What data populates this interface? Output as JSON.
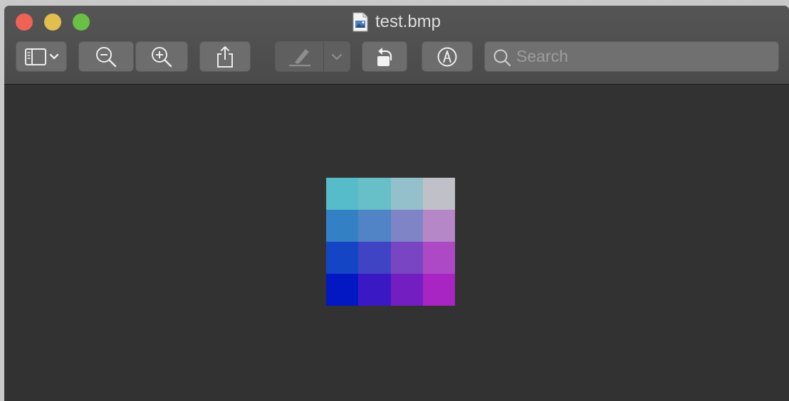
{
  "window": {
    "title": "test.bmp"
  },
  "toolbar": {
    "buttons": [
      {
        "name": "sidebar-toggle",
        "icon": "sidebar-icon"
      },
      {
        "name": "zoom-out",
        "icon": "zoom-out-icon"
      },
      {
        "name": "zoom-in",
        "icon": "zoom-in-icon"
      },
      {
        "name": "share",
        "icon": "share-icon"
      },
      {
        "name": "highlight",
        "icon": "highlighter-icon"
      },
      {
        "name": "rotate",
        "icon": "rotate-left-icon"
      },
      {
        "name": "markup",
        "icon": "markup-icon"
      }
    ]
  },
  "search": {
    "placeholder": "Search",
    "value": ""
  },
  "image": {
    "pixels": [
      [
        "#57bcc9",
        "#67bfc7",
        "#93c0cb",
        "#c0c0c8"
      ],
      [
        "#3380c4",
        "#5184c6",
        "#7f84c7",
        "#b587c7"
      ],
      [
        "#1445c4",
        "#3f44c4",
        "#7945c2",
        "#ae49c5"
      ],
      [
        "#0218c2",
        "#3a19c4",
        "#721ec0",
        "#a824c3"
      ]
    ]
  }
}
